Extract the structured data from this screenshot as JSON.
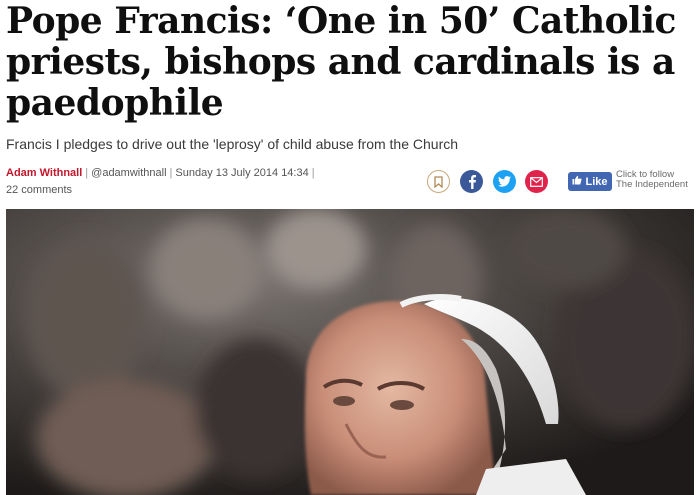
{
  "article": {
    "headline": "Pope Francis: ‘One in 50’ Catholic priests, bishops and cardinals is a paedophile",
    "standfirst": "Francis I pledges to drive out the 'leprosy' of child abuse from the Church",
    "author": "Adam Withnall",
    "twitter_handle": "@adamwithnall",
    "date": "Sunday 13 July 2014 14:34",
    "comments": "22 comments"
  },
  "share": {
    "icons": [
      "bookmark-icon",
      "facebook-icon",
      "twitter-icon",
      "email-icon"
    ],
    "like_label": "Like",
    "follow_text_line1": "Click to follow",
    "follow_text_line2": "The Independent"
  },
  "colors": {
    "author": "#c4162a",
    "facebook": "#3b5998",
    "twitter": "#1da1f2",
    "email": "#e0234a",
    "fb_like": "#4267b2",
    "bookmark_ring": "#c8a87a"
  },
  "hero_image": {
    "subject": "pope"
  }
}
